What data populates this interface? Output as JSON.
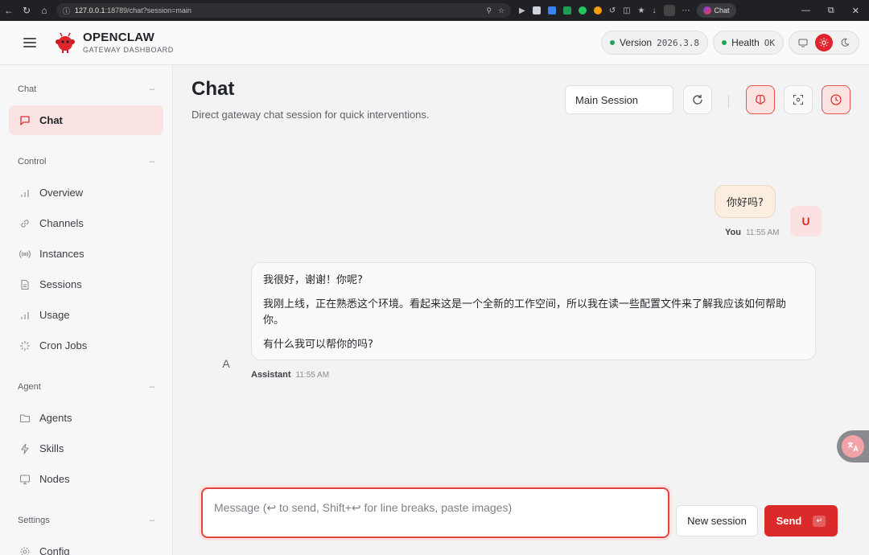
{
  "browser": {
    "url_host": "127.0.0.1",
    "url_path": ":18789/chat?session=main",
    "tab_label": "Chat"
  },
  "header": {
    "brand_title": "OPENCLAW",
    "brand_subtitle": "GATEWAY DASHBOARD",
    "version_label": "Version",
    "version_value": "2026.3.8",
    "health_label": "Health",
    "health_value": "OK"
  },
  "sidebar": {
    "groups": [
      {
        "label": "Chat",
        "items": [
          {
            "label": "Chat",
            "icon": "message-icon",
            "active": true
          }
        ]
      },
      {
        "label": "Control",
        "items": [
          {
            "label": "Overview",
            "icon": "bar-chart-icon"
          },
          {
            "label": "Channels",
            "icon": "link-icon"
          },
          {
            "label": "Instances",
            "icon": "radio-icon"
          },
          {
            "label": "Sessions",
            "icon": "document-icon"
          },
          {
            "label": "Usage",
            "icon": "bar-chart-icon"
          },
          {
            "label": "Cron Jobs",
            "icon": "loader-icon"
          }
        ]
      },
      {
        "label": "Agent",
        "items": [
          {
            "label": "Agents",
            "icon": "folder-icon"
          },
          {
            "label": "Skills",
            "icon": "bolt-icon"
          },
          {
            "label": "Nodes",
            "icon": "monitor-icon"
          }
        ]
      },
      {
        "label": "Settings",
        "items": [
          {
            "label": "Config",
            "icon": "gear-icon"
          }
        ]
      }
    ]
  },
  "main": {
    "title": "Chat",
    "subtitle": "Direct gateway chat session for quick interventions.",
    "session_select": "Main Session",
    "messages": {
      "user": {
        "text": "你好吗?",
        "author": "You",
        "time": "11:55 AM",
        "avatar": "U"
      },
      "assistant": {
        "paragraphs": [
          "我很好，谢谢！你呢?",
          "我刚上线，正在熟悉这个环境。看起来这是一个全新的工作空间，所以我在读一些配置文件来了解我应该如何帮助你。",
          "有什么我可以帮你的吗?"
        ],
        "author": "Assistant",
        "time": "11:55 AM",
        "avatar": "A"
      }
    },
    "composer_placeholder": "Message (↩ to send, Shift+↩ for line breaks, paste images)",
    "new_session_label": "New session",
    "send_label": "Send",
    "send_kbd": "↵"
  },
  "colors": {
    "accent": "#db2a2a",
    "health_dot": "#22a355"
  }
}
